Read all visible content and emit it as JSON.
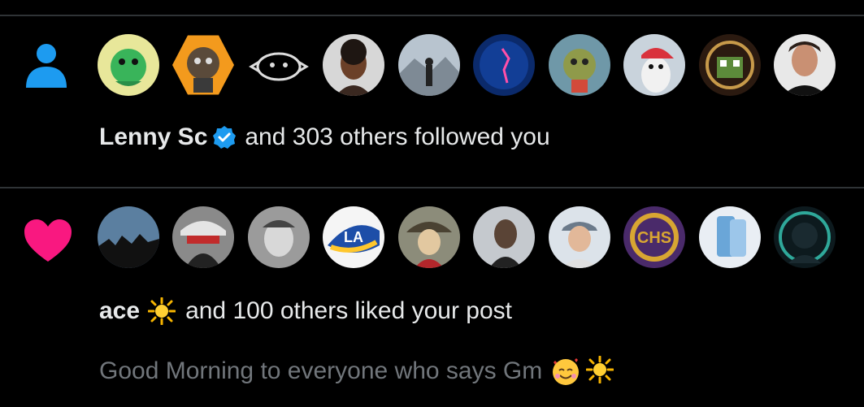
{
  "notifications": [
    {
      "type": "follow",
      "icon": "person-icon",
      "icon_color": "#1d9bf0",
      "actor_name": "Lenny Sc",
      "actor_badge": "verified-badge-icon",
      "summary": "and 303 others followed you",
      "avatars": [
        "avatar-yellow-creature",
        "avatar-orange-ape",
        "avatar-line-drawing",
        "avatar-woman",
        "avatar-man-mountains",
        "avatar-blue-deep-sea",
        "avatar-green-ape",
        "avatar-penguin-red-cap",
        "avatar-pixel-frog",
        "avatar-smiling-man"
      ]
    },
    {
      "type": "like",
      "icon": "heart-icon",
      "icon_color": "#f91880",
      "actor_name": "ace",
      "actor_emoji": "sun-icon",
      "summary": "and 100 others liked your post",
      "post_preview": "Good Morning to everyone who says Gm",
      "preview_emojis": [
        "smiling-face-hearts-icon",
        "sun-icon"
      ],
      "avatars": [
        "avatar-silhouettes",
        "avatar-anime-cap",
        "avatar-grey-person",
        "avatar-rams-logo",
        "avatar-anime-hat",
        "avatar-man-dark",
        "avatar-man-cap",
        "avatar-chs-logo",
        "avatar-phone",
        "avatar-astronaut"
      ]
    }
  ]
}
